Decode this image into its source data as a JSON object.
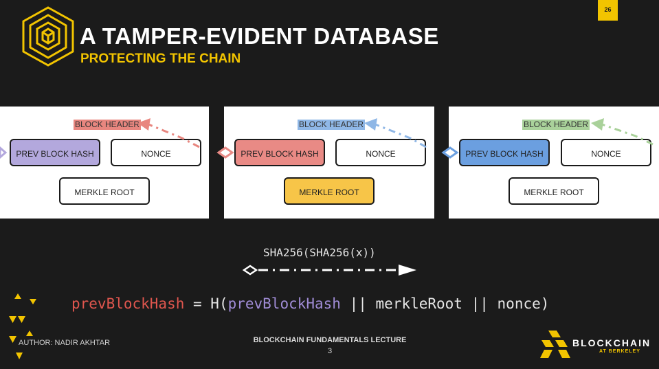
{
  "slide": {
    "page_number": "26",
    "title": "A TAMPER-EVIDENT DATABASE",
    "subtitle": "PROTECTING THE CHAIN"
  },
  "blocks": [
    {
      "header_label": "BLOCK HEADER",
      "header_color": "#e8867f",
      "prev_hash_label": "PREV BLOCK HASH",
      "prev_hash_color": "#b3a8dd",
      "nonce_label": "NONCE",
      "merkle_label": "MERKLE ROOT",
      "merkle_color": "#ffffff"
    },
    {
      "header_label": "BLOCK HEADER",
      "header_color": "#8fb7e6",
      "prev_hash_label": "PREV BLOCK HASH",
      "prev_hash_color": "#e98a85",
      "nonce_label": "NONCE",
      "merkle_label": "MERKLE ROOT",
      "merkle_color": "#f7c548"
    },
    {
      "header_label": "BLOCK HEADER",
      "header_color": "#a9d19a",
      "prev_hash_label": "PREV BLOCK HASH",
      "prev_hash_color": "#6b9fe0",
      "nonce_label": "NONCE",
      "merkle_label": "MERKLE ROOT",
      "merkle_color": "#ffffff"
    }
  ],
  "legend": {
    "function_label": "SHA256(SHA256(x))"
  },
  "formula": {
    "lhs": "prevBlockHash",
    "equals": " = H(",
    "arg1": "prevBlockHash",
    "rest": " || merkleRoot || nonce)"
  },
  "footer": {
    "author": "AUTHOR: NADIR AKHTAR",
    "lecture": "BLOCKCHAIN FUNDAMENTALS LECTURE",
    "lecture_number": "3",
    "org_name": "BLOCKCHAIN",
    "org_subtitle": "AT BERKELEY"
  },
  "colors": {
    "accent": "#f2c400",
    "background": "#1b1b1b"
  }
}
